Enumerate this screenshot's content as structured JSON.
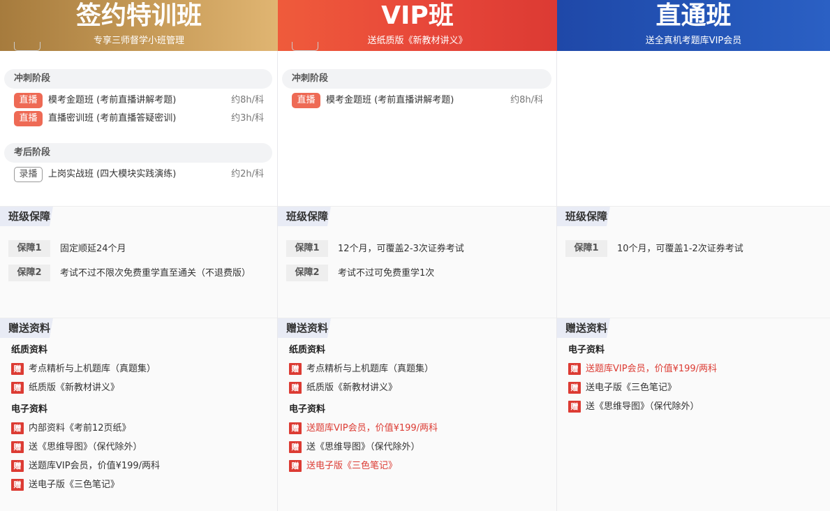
{
  "columns": [
    {
      "title": "签约特训班",
      "subtitle": "专享三师督学小班管理",
      "stages": [
        {
          "name": "冲刺阶段",
          "courses": [
            {
              "tag": "直播",
              "tag_type": "live",
              "name": "模考金题班 (考前直播讲解考题)",
              "hours": "约8h/科"
            },
            {
              "tag": "直播",
              "tag_type": "live",
              "name": "直播密训班 (考前直播答疑密训)",
              "hours": "约3h/科"
            }
          ]
        },
        {
          "name": "考后阶段",
          "courses": [
            {
              "tag": "录播",
              "tag_type": "rec",
              "name": "上岗实战班 (四大模块实践演练)",
              "hours": "约2h/科"
            }
          ]
        }
      ],
      "guarantee_title": "班级保障",
      "guarantees": [
        {
          "badge": "保障1",
          "text": "固定顺延24个月"
        },
        {
          "badge": "保障2",
          "text": "考试不过不限次免费重学直至通关（不退费版）"
        }
      ],
      "materials_title": "赠送资料",
      "materials": [
        {
          "heading": "纸质资料",
          "items": [
            {
              "gift": "赠",
              "text": "考点精析与上机题库（真题集）",
              "color": "black"
            },
            {
              "gift": "赠",
              "text": "纸质版《新教材讲义》",
              "color": "black"
            }
          ]
        },
        {
          "heading": "电子资料",
          "items": [
            {
              "gift": "赠",
              "text": "内部资料《考前12页纸》",
              "color": "black"
            },
            {
              "gift": "赠",
              "text": "送《思维导图》（保代除外）",
              "color": "black"
            },
            {
              "gift": "赠",
              "text": "送题库VIP会员，价值¥199/两科",
              "color": "black"
            },
            {
              "gift": "赠",
              "text": "送电子版《三色笔记》",
              "color": "black"
            }
          ]
        }
      ]
    },
    {
      "title": "VIP班",
      "subtitle": "送纸质版《新教材讲义》",
      "stages": [
        {
          "name": "冲刺阶段",
          "courses": [
            {
              "tag": "直播",
              "tag_type": "live",
              "name": "模考金题班 (考前直播讲解考题)",
              "hours": "约8h/科"
            }
          ]
        }
      ],
      "guarantee_title": "班级保障",
      "guarantees": [
        {
          "badge": "保障1",
          "text": "12个月，可覆盖2-3次证券考试"
        },
        {
          "badge": "保障2",
          "text": "考试不过可免费重学1次"
        }
      ],
      "materials_title": "赠送资料",
      "materials": [
        {
          "heading": "纸质资料",
          "items": [
            {
              "gift": "赠",
              "text": "考点精析与上机题库（真题集）",
              "color": "black"
            },
            {
              "gift": "赠",
              "text": "纸质版《新教材讲义》",
              "color": "black"
            }
          ]
        },
        {
          "heading": "电子资料",
          "items": [
            {
              "gift": "赠",
              "text": "送题库VIP会员，价值¥199/两科",
              "color": "red"
            },
            {
              "gift": "赠",
              "text": "送《思维导图》（保代除外）",
              "color": "black"
            },
            {
              "gift": "赠",
              "text": "送电子版《三色笔记》",
              "color": "red"
            }
          ]
        }
      ]
    },
    {
      "title": "直通班",
      "subtitle": "送全真机考题库VIP会员",
      "stages": [],
      "guarantee_title": "班级保障",
      "guarantees": [
        {
          "badge": "保障1",
          "text": "10个月，可覆盖1-2次证券考试"
        }
      ],
      "materials_title": "赠送资料",
      "materials": [
        {
          "heading": "电子资料",
          "items": [
            {
              "gift": "赠",
              "text": "送题库VIP会员，价值¥199/两科",
              "color": "red"
            },
            {
              "gift": "赠",
              "text": "送电子版《三色笔记》",
              "color": "black"
            },
            {
              "gift": "赠",
              "text": "送《思维导图》（保代除外）",
              "color": "black"
            }
          ]
        }
      ]
    }
  ],
  "colors": {
    "gold": "#c79b58",
    "red": "#e8483a",
    "blue": "#2456b8",
    "gift_red": "#dc3b33",
    "live_tag": "#ee6a55"
  }
}
